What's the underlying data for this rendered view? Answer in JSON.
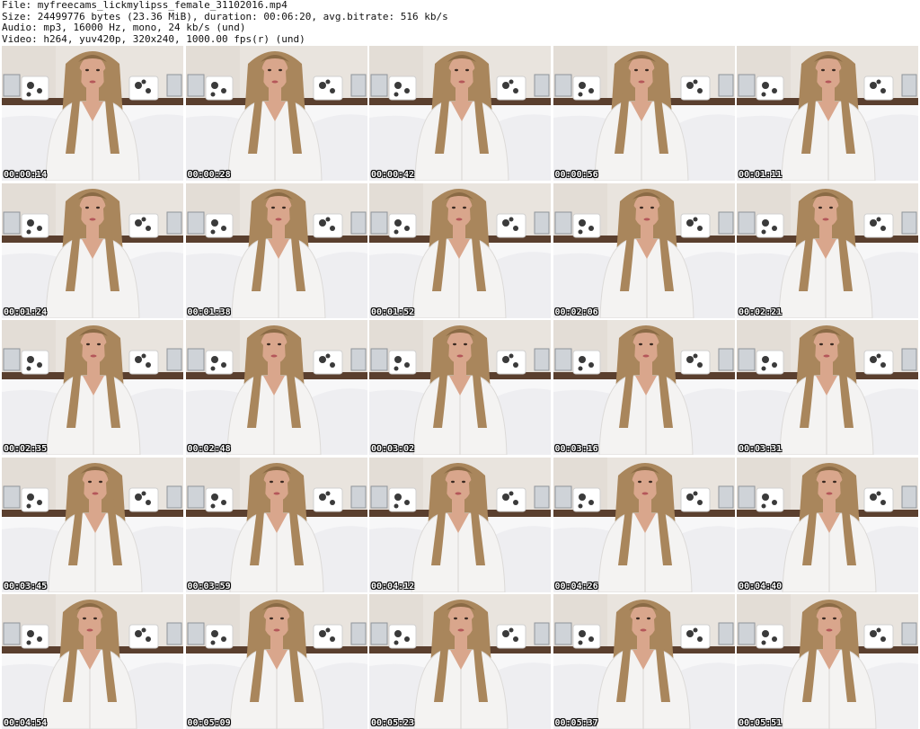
{
  "header": {
    "file_line": "File: myfreecams_lickmylipss_female_31102016.mp4",
    "size_line": "Size: 24499776 bytes (23.36 MiB), duration: 00:06:20, avg.bitrate: 516 kb/s",
    "audio_line": "Audio: mp3, 16000 Hz, mono, 24 kb/s (und)",
    "video_line": "Video: h264, yuv420p, 320x240, 1000.00 fps(r) (und)"
  },
  "colors": {
    "wall": "#e9e4de",
    "sheet": "#f7f7f8",
    "headboard": "#5a3f2e",
    "hair": "#a9865c",
    "blouse": "#f4f3f2",
    "skin": "#d9a68c",
    "pillow": "#ffffff",
    "pillow_print": "#3a3a3a"
  },
  "thumbnails": [
    {
      "timestamp": "00:00:14"
    },
    {
      "timestamp": "00:00:28"
    },
    {
      "timestamp": "00:00:42"
    },
    {
      "timestamp": "00:00:56"
    },
    {
      "timestamp": "00:01:11"
    },
    {
      "timestamp": "00:01:24"
    },
    {
      "timestamp": "00:01:38"
    },
    {
      "timestamp": "00:01:52"
    },
    {
      "timestamp": "00:02:06"
    },
    {
      "timestamp": "00:02:21"
    },
    {
      "timestamp": "00:02:35"
    },
    {
      "timestamp": "00:02:48"
    },
    {
      "timestamp": "00:03:02"
    },
    {
      "timestamp": "00:03:16"
    },
    {
      "timestamp": "00:03:31"
    },
    {
      "timestamp": "00:03:45"
    },
    {
      "timestamp": "00:03:59"
    },
    {
      "timestamp": "00:04:12"
    },
    {
      "timestamp": "00:04:26"
    },
    {
      "timestamp": "00:04:40"
    },
    {
      "timestamp": "00:04:54"
    },
    {
      "timestamp": "00:05:09"
    },
    {
      "timestamp": "00:05:23"
    },
    {
      "timestamp": "00:05:37"
    },
    {
      "timestamp": "00:05:51"
    }
  ]
}
